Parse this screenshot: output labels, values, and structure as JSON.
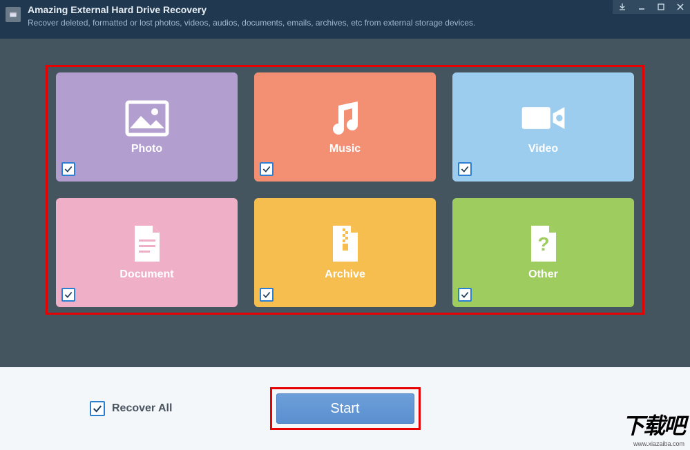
{
  "header": {
    "title": "Amazing External Hard Drive Recovery",
    "subtitle": "Recover deleted, formatted or lost photos, videos, audios, documents, emails, archives, etc from external storage devices."
  },
  "tiles": [
    {
      "id": "photo",
      "label": "Photo",
      "checked": true
    },
    {
      "id": "music",
      "label": "Music",
      "checked": true
    },
    {
      "id": "video",
      "label": "Video",
      "checked": true
    },
    {
      "id": "document",
      "label": "Document",
      "checked": true
    },
    {
      "id": "archive",
      "label": "Archive",
      "checked": true
    },
    {
      "id": "other",
      "label": "Other",
      "checked": true
    }
  ],
  "footer": {
    "recover_all_label": "Recover All",
    "recover_all_checked": true,
    "start_label": "Start"
  },
  "watermark": {
    "main": "下载吧",
    "sub": "www.xiazaiba.com"
  }
}
